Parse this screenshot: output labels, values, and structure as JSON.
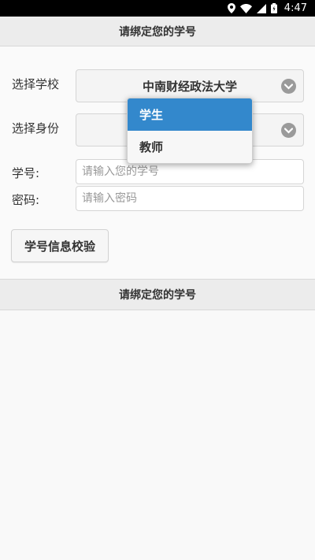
{
  "status_bar": {
    "time": "4:47",
    "icons": [
      "location-icon",
      "wifi-icon",
      "signal-icon",
      "battery-icon"
    ]
  },
  "header": {
    "title": "请绑定您的学号"
  },
  "form": {
    "school_label": "选择学校",
    "school_value": "中南财经政法大学",
    "identity_label": "选择身份",
    "identity_value": "学生",
    "student_id_label": "学号:",
    "student_id_placeholder": "请输入您的学号",
    "student_id_value": "",
    "password_label": "密码:",
    "password_placeholder": "请输入密码",
    "password_value": "",
    "verify_button": "学号信息校验"
  },
  "identity_dropdown": {
    "options": [
      "学生",
      "教师"
    ],
    "selected": "学生",
    "selected_color": "#3388cc"
  },
  "footer": {
    "title": "请绑定您的学号"
  }
}
